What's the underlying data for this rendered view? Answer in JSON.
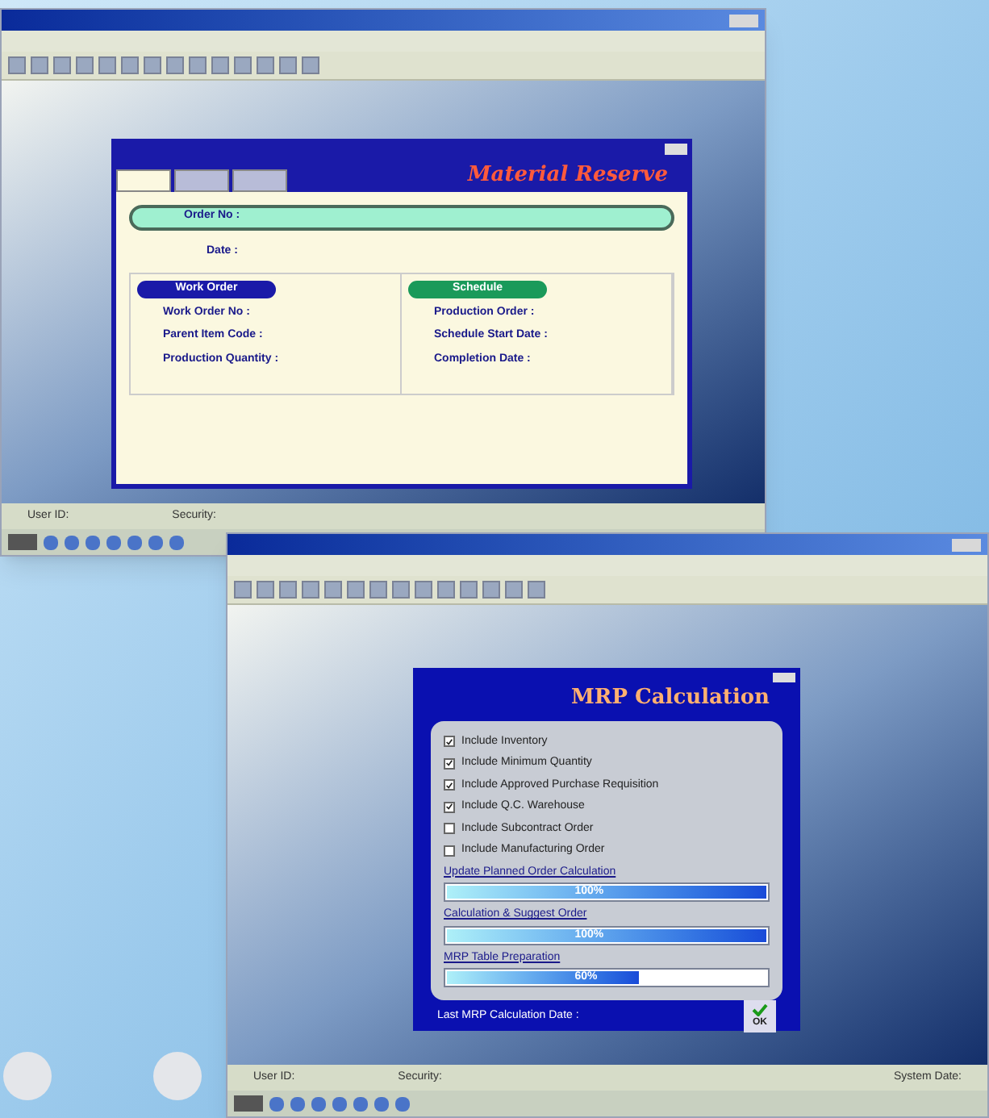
{
  "reserve_window": {
    "dialog": {
      "title": "Material Reserve",
      "tabs": [
        {
          "selected": true
        },
        {
          "selected": false
        },
        {
          "selected": false
        }
      ],
      "order_label": "Order No :",
      "date_label": "Date :",
      "work_order": {
        "heading": "Work Order",
        "fields": [
          "Work Order No :",
          "Parent Item Code :",
          "Production Quantity :"
        ]
      },
      "schedule": {
        "heading": "Schedule",
        "fields": [
          "Production Order :",
          "Schedule Start Date :",
          "Completion Date :"
        ]
      }
    },
    "status_bar": [
      "User ID:",
      "Security:"
    ]
  },
  "mrp_window": {
    "dialog": {
      "title": "MRP Calculation",
      "options": [
        {
          "label": "Include Inventory",
          "checked": true
        },
        {
          "label": "Include Minimum Quantity",
          "checked": true
        },
        {
          "label": "Include Approved Purchase Requisition",
          "checked": true
        },
        {
          "label": "Include Q.C. Warehouse",
          "checked": true
        },
        {
          "label": "Include Subcontract Order",
          "checked": false
        },
        {
          "label": "Include Manufacturing Order",
          "checked": false
        }
      ],
      "progress": [
        {
          "label": "Update Planned Order Calculation",
          "level": 1,
          "reading": "100%"
        },
        {
          "label": "Calculation & Suggest Order",
          "level": 1,
          "reading": "100%"
        },
        {
          "label": "MRP Table Preparation",
          "level": 0.6,
          "reading": "60%"
        }
      ],
      "footer_label": "Last MRP Calculation Date :",
      "ok": "OK"
    },
    "status_bar": [
      "User ID:",
      "Security:",
      "System Date:"
    ]
  }
}
